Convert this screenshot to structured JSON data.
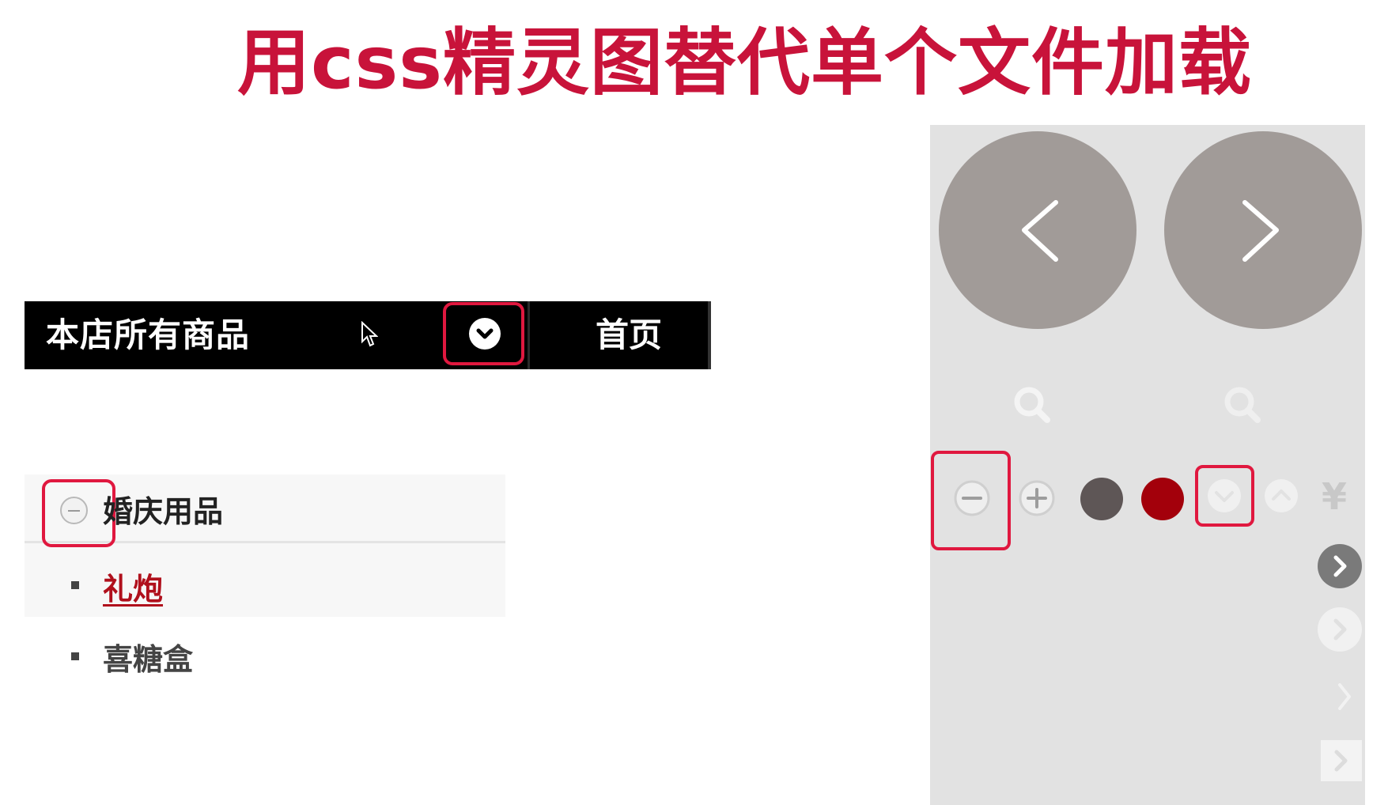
{
  "title": "用css精灵图替代单个文件加载",
  "navbar": {
    "all_products_label": "本店所有商品",
    "home_label": "首页"
  },
  "category": {
    "title": "婚庆用品",
    "items": [
      {
        "label": "礼炮",
        "active": true
      },
      {
        "label": "喜糖盒",
        "active": false
      }
    ]
  },
  "sprite_sheet": {
    "currency_label": "¥",
    "icons": [
      "arrow-left-circle-icon",
      "arrow-right-circle-icon",
      "search-icon",
      "search-icon-light",
      "minus-circle-icon",
      "plus-circle-icon",
      "dark-gray-dot",
      "dark-red-dot",
      "chevron-down-icon",
      "chevron-up-icon",
      "yen-icon",
      "chevron-right-dark-circle-icon",
      "chevron-right-light-circle-icon",
      "chevron-right-thin-icon",
      "chevron-right-square-icon"
    ],
    "colors": {
      "dark_gray_dot": "#5e5656",
      "dark_red_dot": "#a3000b",
      "circle_fill": "#a19b98"
    }
  },
  "colors": {
    "title": "#c8133a",
    "highlight": "#e0183f",
    "active_link": "#b0101c"
  }
}
